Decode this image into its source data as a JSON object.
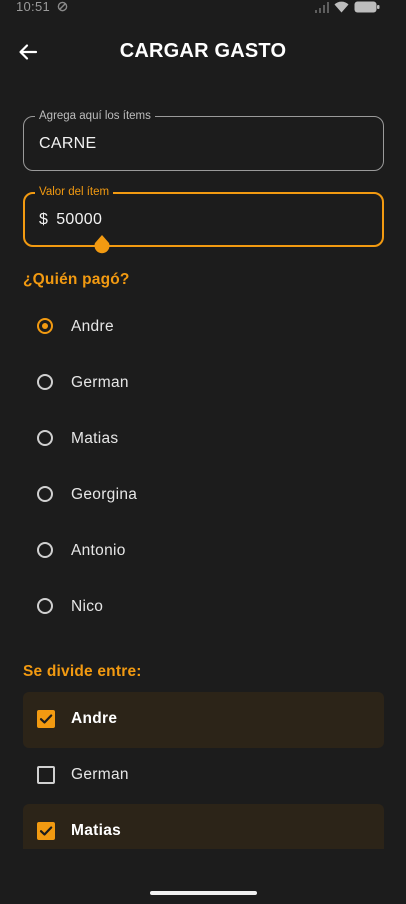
{
  "status_bar": {
    "time": "10:51"
  },
  "header": {
    "title": "CARGAR GASTO"
  },
  "items_field": {
    "label": "Agrega aquí los ítems",
    "value": "CARNE"
  },
  "value_field": {
    "label": "Valor del ítem",
    "prefix": "$",
    "value": "50000"
  },
  "payer_section": {
    "title": "¿Quién pagó?",
    "selected": "Andre",
    "options": [
      "Andre",
      "German",
      "Matias",
      "Georgina",
      "Antonio",
      "Nico"
    ]
  },
  "split_section": {
    "title": "Se divide entre:",
    "options": [
      {
        "label": "Andre",
        "checked": true
      },
      {
        "label": "German",
        "checked": false
      },
      {
        "label": "Matias",
        "checked": true
      }
    ]
  },
  "colors": {
    "accent": "#f29a11",
    "background": "#1c1c1c",
    "selected_row": "#2c2418"
  }
}
